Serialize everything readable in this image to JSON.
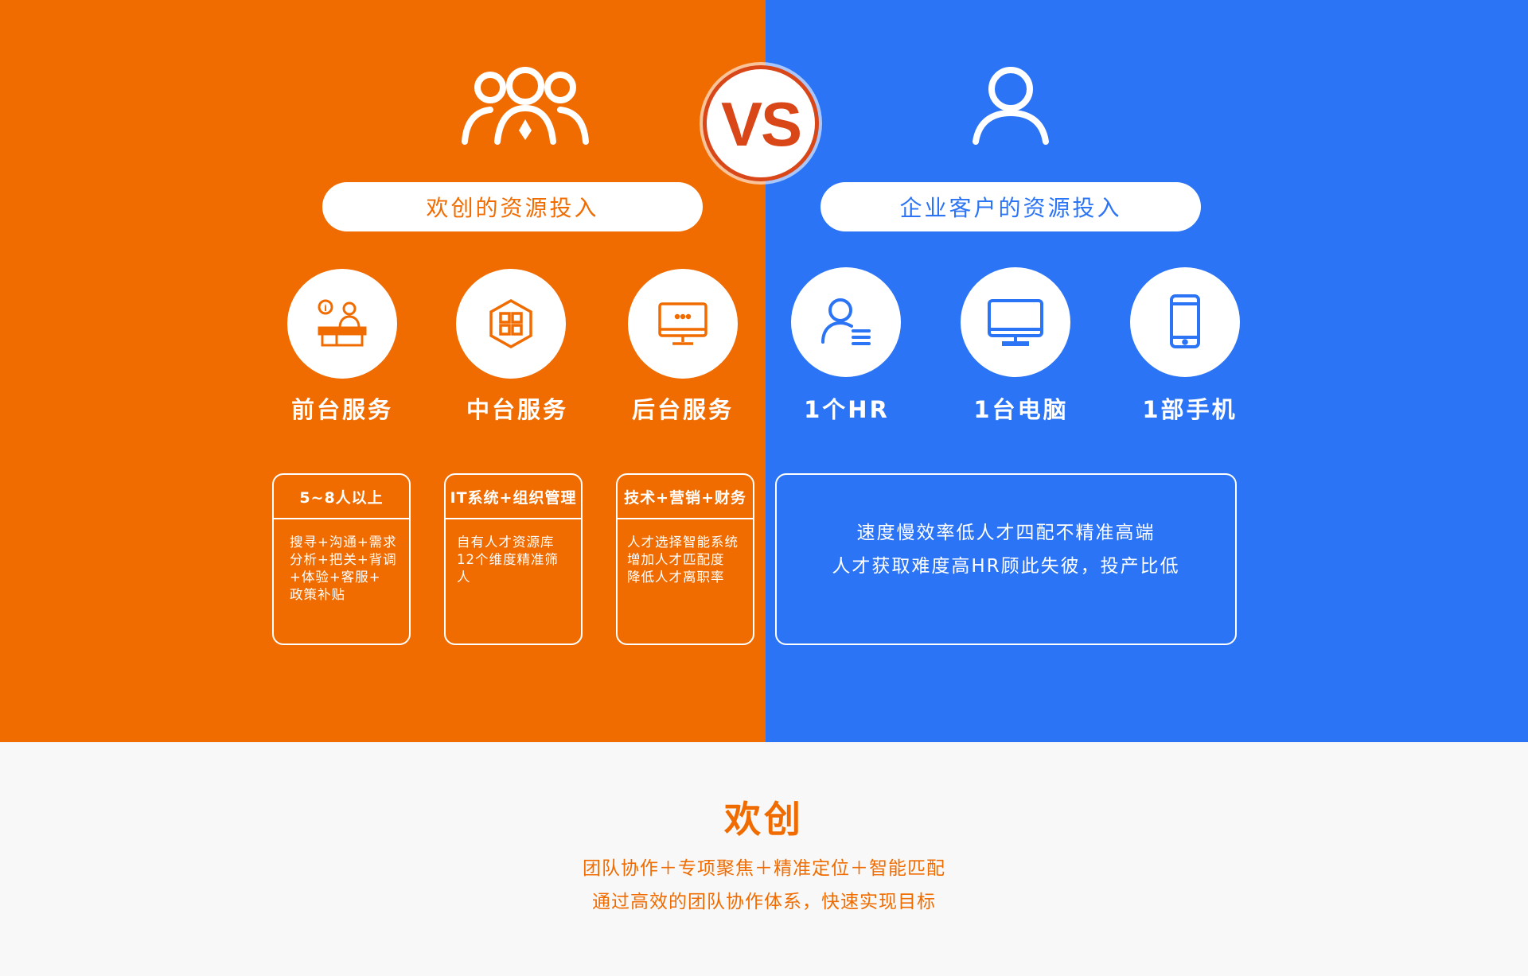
{
  "colors": {
    "orange": "#f06c00",
    "blue": "#2b74f6",
    "vs_red": "#d94618",
    "bottom_bg": "#f8f8f8"
  },
  "vs": {
    "label": "VS"
  },
  "left": {
    "icon": "team-icon",
    "pill": "欢创的资源投入",
    "items": [
      {
        "label": "前台服务",
        "icon": "reception-desk-icon"
      },
      {
        "label": "中台服务",
        "icon": "grid-box-icon"
      },
      {
        "label": "后台服务",
        "icon": "monitor-dots-icon"
      }
    ],
    "cards": [
      {
        "title": "5~8人以上",
        "lines": [
          "搜寻+沟通+需求",
          "分析+把关+背调",
          "+体验+客服+",
          "政策补贴"
        ]
      },
      {
        "title": "IT系统+组织管理",
        "lines": [
          "自有人才资源库",
          "12个维度精准筛人"
        ]
      },
      {
        "title": "技术+营销+财务",
        "lines": [
          "人才选择智能系统",
          "增加人才匹配度",
          "降低人才离职率"
        ]
      }
    ]
  },
  "right": {
    "icon": "person-icon",
    "pill": "企业客户的资源投入",
    "items": [
      {
        "label": "1个HR",
        "icon": "hr-person-icon"
      },
      {
        "label": "1台电脑",
        "icon": "desktop-icon"
      },
      {
        "label": "1部手机",
        "icon": "mobile-phone-icon"
      }
    ],
    "card": {
      "lines": [
        "速度慢效率低人才四配不精准高端",
        "人才获取难度高HR顾此失彼，投产比低"
      ]
    }
  },
  "bottom": {
    "title": "欢创",
    "line1": "团队协作＋专项聚焦＋精准定位＋智能匹配",
    "line2": "通过高效的团队协作体系，快速实现目标"
  }
}
